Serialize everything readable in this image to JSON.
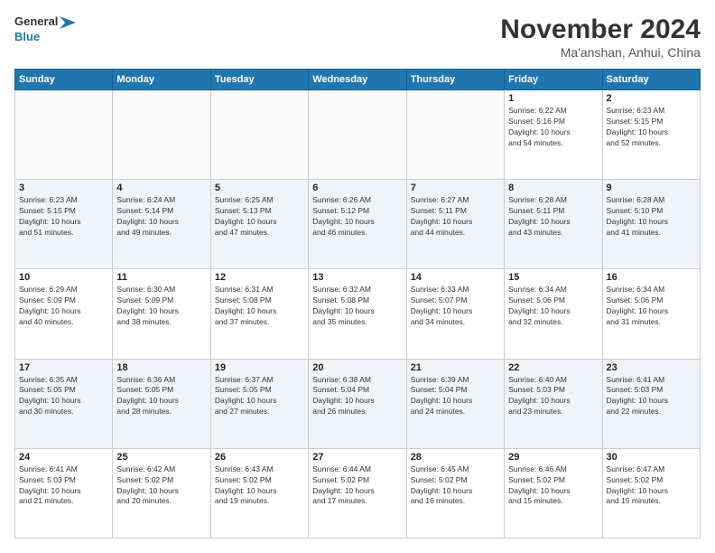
{
  "header": {
    "logo_line1": "General",
    "logo_line2": "Blue",
    "month": "November 2024",
    "location": "Ma'anshan, Anhui, China"
  },
  "weekdays": [
    "Sunday",
    "Monday",
    "Tuesday",
    "Wednesday",
    "Thursday",
    "Friday",
    "Saturday"
  ],
  "weeks": [
    [
      {
        "day": "",
        "info": ""
      },
      {
        "day": "",
        "info": ""
      },
      {
        "day": "",
        "info": ""
      },
      {
        "day": "",
        "info": ""
      },
      {
        "day": "",
        "info": ""
      },
      {
        "day": "1",
        "info": "Sunrise: 6:22 AM\nSunset: 5:16 PM\nDaylight: 10 hours\nand 54 minutes."
      },
      {
        "day": "2",
        "info": "Sunrise: 6:23 AM\nSunset: 5:15 PM\nDaylight: 10 hours\nand 52 minutes."
      }
    ],
    [
      {
        "day": "3",
        "info": "Sunrise: 6:23 AM\nSunset: 5:15 PM\nDaylight: 10 hours\nand 51 minutes."
      },
      {
        "day": "4",
        "info": "Sunrise: 6:24 AM\nSunset: 5:14 PM\nDaylight: 10 hours\nand 49 minutes."
      },
      {
        "day": "5",
        "info": "Sunrise: 6:25 AM\nSunset: 5:13 PM\nDaylight: 10 hours\nand 47 minutes."
      },
      {
        "day": "6",
        "info": "Sunrise: 6:26 AM\nSunset: 5:12 PM\nDaylight: 10 hours\nand 46 minutes."
      },
      {
        "day": "7",
        "info": "Sunrise: 6:27 AM\nSunset: 5:11 PM\nDaylight: 10 hours\nand 44 minutes."
      },
      {
        "day": "8",
        "info": "Sunrise: 6:28 AM\nSunset: 5:11 PM\nDaylight: 10 hours\nand 43 minutes."
      },
      {
        "day": "9",
        "info": "Sunrise: 6:28 AM\nSunset: 5:10 PM\nDaylight: 10 hours\nand 41 minutes."
      }
    ],
    [
      {
        "day": "10",
        "info": "Sunrise: 6:29 AM\nSunset: 5:09 PM\nDaylight: 10 hours\nand 40 minutes."
      },
      {
        "day": "11",
        "info": "Sunrise: 6:30 AM\nSunset: 5:09 PM\nDaylight: 10 hours\nand 38 minutes."
      },
      {
        "day": "12",
        "info": "Sunrise: 6:31 AM\nSunset: 5:08 PM\nDaylight: 10 hours\nand 37 minutes."
      },
      {
        "day": "13",
        "info": "Sunrise: 6:32 AM\nSunset: 5:08 PM\nDaylight: 10 hours\nand 35 minutes."
      },
      {
        "day": "14",
        "info": "Sunrise: 6:33 AM\nSunset: 5:07 PM\nDaylight: 10 hours\nand 34 minutes."
      },
      {
        "day": "15",
        "info": "Sunrise: 6:34 AM\nSunset: 5:06 PM\nDaylight: 10 hours\nand 32 minutes."
      },
      {
        "day": "16",
        "info": "Sunrise: 6:34 AM\nSunset: 5:06 PM\nDaylight: 10 hours\nand 31 minutes."
      }
    ],
    [
      {
        "day": "17",
        "info": "Sunrise: 6:35 AM\nSunset: 5:05 PM\nDaylight: 10 hours\nand 30 minutes."
      },
      {
        "day": "18",
        "info": "Sunrise: 6:36 AM\nSunset: 5:05 PM\nDaylight: 10 hours\nand 28 minutes."
      },
      {
        "day": "19",
        "info": "Sunrise: 6:37 AM\nSunset: 5:05 PM\nDaylight: 10 hours\nand 27 minutes."
      },
      {
        "day": "20",
        "info": "Sunrise: 6:38 AM\nSunset: 5:04 PM\nDaylight: 10 hours\nand 26 minutes."
      },
      {
        "day": "21",
        "info": "Sunrise: 6:39 AM\nSunset: 5:04 PM\nDaylight: 10 hours\nand 24 minutes."
      },
      {
        "day": "22",
        "info": "Sunrise: 6:40 AM\nSunset: 5:03 PM\nDaylight: 10 hours\nand 23 minutes."
      },
      {
        "day": "23",
        "info": "Sunrise: 6:41 AM\nSunset: 5:03 PM\nDaylight: 10 hours\nand 22 minutes."
      }
    ],
    [
      {
        "day": "24",
        "info": "Sunrise: 6:41 AM\nSunset: 5:03 PM\nDaylight: 10 hours\nand 21 minutes."
      },
      {
        "day": "25",
        "info": "Sunrise: 6:42 AM\nSunset: 5:02 PM\nDaylight: 10 hours\nand 20 minutes."
      },
      {
        "day": "26",
        "info": "Sunrise: 6:43 AM\nSunset: 5:02 PM\nDaylight: 10 hours\nand 19 minutes."
      },
      {
        "day": "27",
        "info": "Sunrise: 6:44 AM\nSunset: 5:02 PM\nDaylight: 10 hours\nand 17 minutes."
      },
      {
        "day": "28",
        "info": "Sunrise: 6:45 AM\nSunset: 5:02 PM\nDaylight: 10 hours\nand 16 minutes."
      },
      {
        "day": "29",
        "info": "Sunrise: 6:46 AM\nSunset: 5:02 PM\nDaylight: 10 hours\nand 15 minutes."
      },
      {
        "day": "30",
        "info": "Sunrise: 6:47 AM\nSunset: 5:02 PM\nDaylight: 10 hours\nand 15 minutes."
      }
    ]
  ]
}
